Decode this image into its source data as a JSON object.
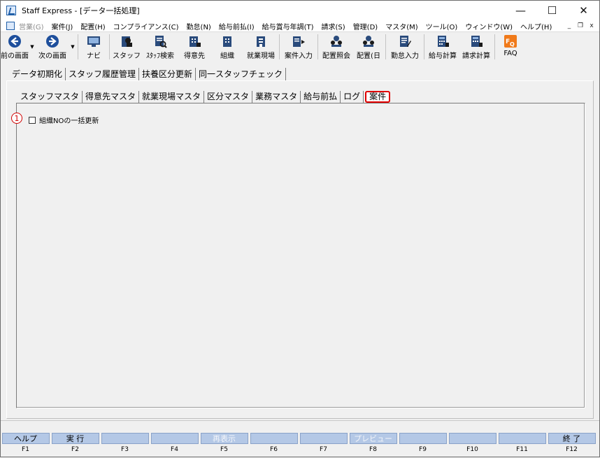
{
  "window": {
    "title": "Staff Express - [データ一括処理]"
  },
  "window_controls": {
    "minimize": "—",
    "maximize": "☐",
    "close": "✕"
  },
  "menubar": {
    "items": [
      {
        "label": "営業(G)",
        "disabled": true
      },
      {
        "label": "案件(J)"
      },
      {
        "label": "配置(H)"
      },
      {
        "label": "コンプライアンス(C)"
      },
      {
        "label": "勤怠(N)"
      },
      {
        "label": "給与前払(I)"
      },
      {
        "label": "給与賞与年調(T)"
      },
      {
        "label": "請求(S)"
      },
      {
        "label": "管理(D)"
      },
      {
        "label": "マスタ(M)"
      },
      {
        "label": "ツール(O)"
      },
      {
        "label": "ウィンドウ(W)"
      },
      {
        "label": "ヘルプ(H)"
      }
    ],
    "mdi": {
      "minimize": "_",
      "restore": "❐",
      "close": "x"
    }
  },
  "toolbar": {
    "items": [
      {
        "label": "前の画面",
        "icon": "back-arrow-icon"
      },
      {
        "label": "次の画面",
        "icon": "forward-arrow-icon"
      },
      {
        "label": "ナビ",
        "icon": "navi-icon"
      },
      {
        "label": "スタッフ",
        "icon": "staff-icon"
      },
      {
        "label": "ｽﾀｯﾌ検索",
        "icon": "staff-search-icon"
      },
      {
        "label": "得意先",
        "icon": "customer-icon"
      },
      {
        "label": "組織",
        "icon": "organization-icon"
      },
      {
        "label": "就業現場",
        "icon": "worksite-icon"
      },
      {
        "label": "案件入力",
        "icon": "case-input-icon"
      },
      {
        "label": "配置照会",
        "icon": "placement-inquiry-icon"
      },
      {
        "label": "配置(日",
        "icon": "placement-daily-icon"
      },
      {
        "label": "勤怠入力",
        "icon": "attendance-input-icon"
      },
      {
        "label": "給与計算",
        "icon": "payroll-calc-icon"
      },
      {
        "label": "請求計算",
        "icon": "billing-calc-icon"
      },
      {
        "label": "FAQ",
        "icon": "faq-icon"
      }
    ]
  },
  "outer_tabs": [
    "データ初期化",
    "スタッフ履歴管理",
    "扶養区分更新",
    "同一スタッフチェック"
  ],
  "inner_tabs": [
    "スタッフマスタ",
    "得意先マスタ",
    "就業現場マスタ",
    "区分マスタ",
    "業務マスタ",
    "給与前払",
    "ログ",
    "案件"
  ],
  "active_inner_tab": "案件",
  "panel": {
    "marker": "1",
    "checkbox_label": "組織NOの一括更新",
    "checked": false
  },
  "fkeys": [
    {
      "label": "ヘルプ",
      "key": "F1",
      "disabled": false
    },
    {
      "label": "実 行",
      "key": "F2",
      "disabled": false
    },
    {
      "label": "",
      "key": "F3",
      "disabled": true
    },
    {
      "label": "",
      "key": "F4",
      "disabled": true
    },
    {
      "label": "再表示",
      "key": "F5",
      "disabled": true
    },
    {
      "label": "",
      "key": "F6",
      "disabled": true
    },
    {
      "label": "",
      "key": "F7",
      "disabled": true
    },
    {
      "label": "プレビュー",
      "key": "F8",
      "disabled": true
    },
    {
      "label": "",
      "key": "F9",
      "disabled": true
    },
    {
      "label": "",
      "key": "F10",
      "disabled": true
    },
    {
      "label": "",
      "key": "F11",
      "disabled": true
    },
    {
      "label": "終 了",
      "key": "F12",
      "disabled": false
    }
  ],
  "colors": {
    "accent_red": "#e00000",
    "fkey_bg": "#b4c8e6"
  }
}
